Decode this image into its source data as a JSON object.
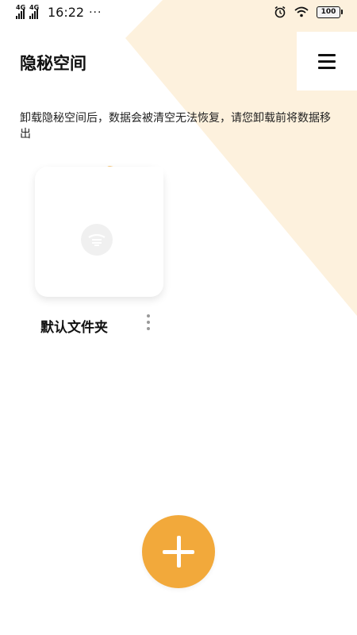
{
  "theme": {
    "accent": "#f2a93b",
    "background_shape": "#fdf1dd",
    "folder_tab": "#f0a82f"
  },
  "status_bar": {
    "signal_1_label": "4G",
    "signal_2_label": "4G",
    "time": "16:22",
    "more": "···",
    "battery": "100",
    "icons": [
      "alarm-icon",
      "wifi-icon",
      "battery-icon"
    ]
  },
  "header": {
    "title": "隐秘空间",
    "menu_icon": "hamburger-menu-icon"
  },
  "notice": "卸载隐秘空间后，数据会被清空无法恢复，请您卸载前将数据移出",
  "folders": [
    {
      "name": "默认文件夹",
      "icon": "folder-icon",
      "more_icon": "more-vertical-icon"
    }
  ],
  "fab": {
    "icon": "plus-icon"
  }
}
